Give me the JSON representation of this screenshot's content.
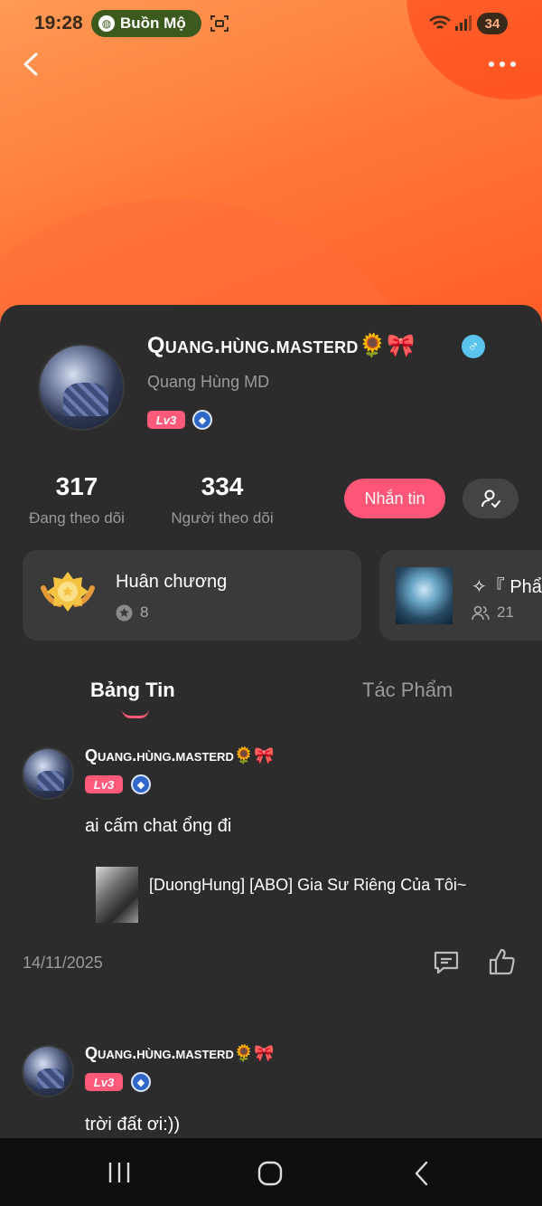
{
  "status_bar": {
    "time": "19:28",
    "notification": "Buồn Mộ",
    "battery": "34"
  },
  "profile": {
    "display_name": "Quang.hùng.masterd🌻🎀",
    "gender_symbol": "♂",
    "username": "Quang Hùng MD",
    "level": "Lv3"
  },
  "stats": {
    "following_count": "317",
    "following_label": "Đang theo dõi",
    "followers_count": "334",
    "followers_label": "Người theo dõi"
  },
  "actions": {
    "message_label": "Nhắn tin"
  },
  "cards": {
    "medal": {
      "title": "Huân chương",
      "count": "8"
    },
    "group": {
      "title": "✧『 Phẩ",
      "members": "21"
    }
  },
  "tabs": {
    "feed": "Bảng Tin",
    "works": "Tác Phẩm"
  },
  "posts": [
    {
      "author": "Quang.hùng.masterd🌻🎀",
      "level": "Lv3",
      "text": "ai cấm chat ổng đi",
      "book_title": "[DuongHung] [ABO] Gia Sư Riêng Của Tôi~",
      "date": "14/11/2025"
    },
    {
      "author": "Quang.hùng.masterd🌻🎀",
      "level": "Lv3",
      "text": "trời đất ơi:))"
    }
  ],
  "colors": {
    "accent": "#ff5577",
    "header_orange": "#ff7a3a",
    "background": "#2c2c2c"
  }
}
